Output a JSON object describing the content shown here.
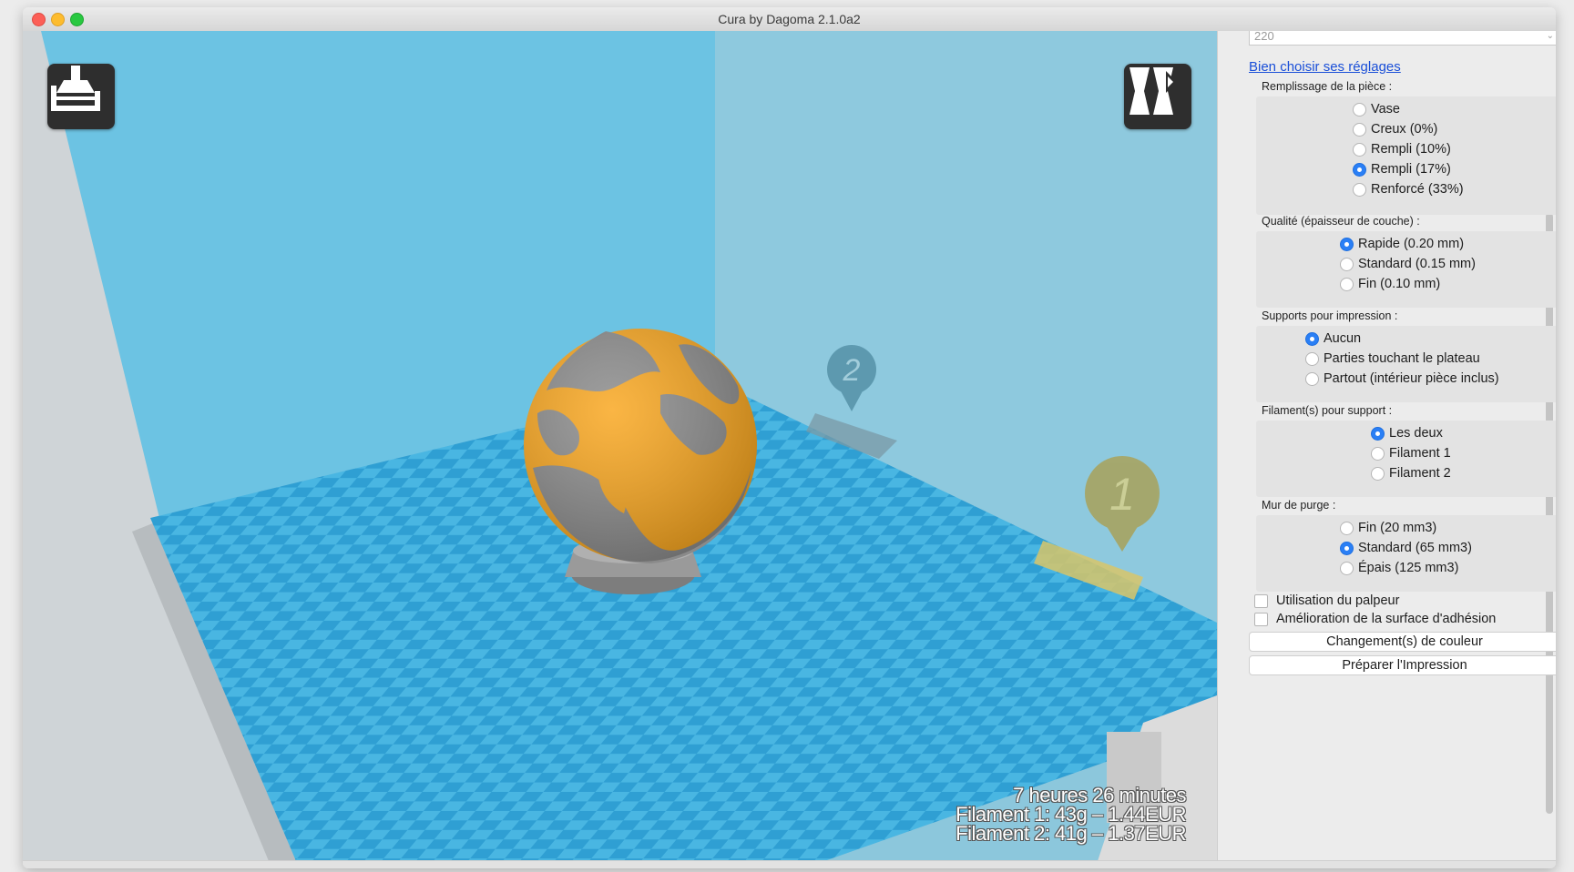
{
  "window": {
    "title": "Cura by Dagoma 2.1.0a2"
  },
  "viewport": {
    "stats": {
      "time": "7 heures 26 minutes",
      "filament1": "Filament 1: 43g – 1.44EUR",
      "filament2": "Filament 2: 41g – 1.37EUR"
    },
    "markers": {
      "marker1": "1",
      "marker2": "2"
    },
    "colors": {
      "plate": "#3fb0de",
      "model": "#f7a21a",
      "model_gray": "#8a8a8a"
    }
  },
  "panel": {
    "top_select_value": "220",
    "settings_link": "Bien choisir ses réglages",
    "groups": {
      "infill": {
        "title": "Remplissage de la pièce :",
        "options": [
          "Vase",
          "Creux (0%)",
          "Rempli (10%)",
          "Rempli (17%)",
          "Renforcé (33%)"
        ],
        "selected": "Rempli (17%)"
      },
      "quality": {
        "title": "Qualité (épaisseur de couche) :",
        "options": [
          "Rapide (0.20 mm)",
          "Standard (0.15 mm)",
          "Fin (0.10 mm)"
        ],
        "selected": "Rapide (0.20 mm)"
      },
      "supports": {
        "title": "Supports pour impression :",
        "options": [
          "Aucun",
          "Parties touchant le plateau",
          "Partout (intérieur pièce inclus)"
        ],
        "selected": "Aucun"
      },
      "support_filament": {
        "title": "Filament(s) pour support :",
        "options": [
          "Les deux",
          "Filament 1",
          "Filament 2"
        ],
        "selected": "Les deux"
      },
      "purge_wall": {
        "title": "Mur de purge :",
        "options": [
          "Fin (20 mm3)",
          "Standard (65 mm3)",
          "Épais (125 mm3)"
        ],
        "selected": "Standard (65 mm3)"
      }
    },
    "checkboxes": {
      "probe": "Utilisation du palpeur",
      "adhesion": "Amélioration de la surface d'adhésion"
    },
    "buttons": {
      "color_change": "Changement(s) de couleur",
      "prepare": "Préparer l'Impression"
    }
  }
}
